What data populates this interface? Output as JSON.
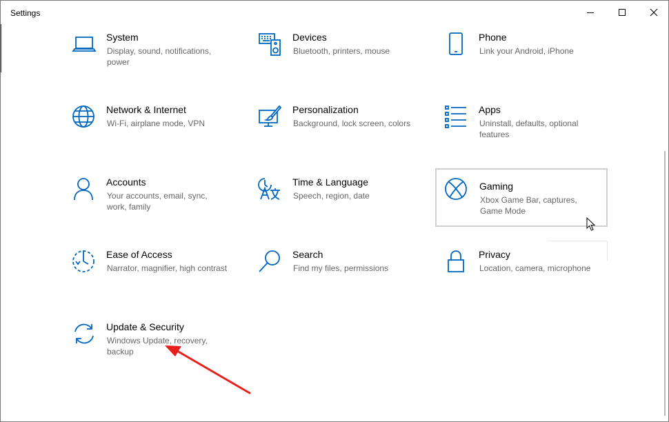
{
  "window": {
    "title": "Settings"
  },
  "colors": {
    "accent": "#0067c0",
    "arrow": "#e8201c",
    "description": "#666666"
  },
  "tiles": [
    {
      "title": "System",
      "desc": "Display, sound, notifications, power",
      "icon": "laptop-icon"
    },
    {
      "title": "Devices",
      "desc": "Bluetooth, printers, mouse",
      "icon": "keyboard-speaker-icon"
    },
    {
      "title": "Phone",
      "desc": "Link your Android, iPhone",
      "icon": "phone-icon"
    },
    {
      "title": "Network & Internet",
      "desc": "Wi-Fi, airplane mode, VPN",
      "icon": "globe-icon"
    },
    {
      "title": "Personalization",
      "desc": "Background, lock screen, colors",
      "icon": "paint-brush-icon"
    },
    {
      "title": "Apps",
      "desc": "Uninstall, defaults, optional features",
      "icon": "apps-list-icon"
    },
    {
      "title": "Accounts",
      "desc": "Your accounts, email, sync, work, family",
      "icon": "person-icon"
    },
    {
      "title": "Time & Language",
      "desc": "Speech, region, date",
      "icon": "language-icon"
    },
    {
      "title": "Gaming",
      "desc": "Xbox Game Bar, captures, Game Mode",
      "icon": "xbox-icon"
    },
    {
      "title": "Ease of Access",
      "desc": "Narrator, magnifier, high contrast",
      "icon": "ease-of-access-icon"
    },
    {
      "title": "Search",
      "desc": "Find my files, permissions",
      "icon": "search-icon"
    },
    {
      "title": "Privacy",
      "desc": "Location, camera, microphone",
      "icon": "lock-icon"
    },
    {
      "title": "Update & Security",
      "desc": "Windows Update, recovery, backup",
      "icon": "sync-icon"
    }
  ]
}
